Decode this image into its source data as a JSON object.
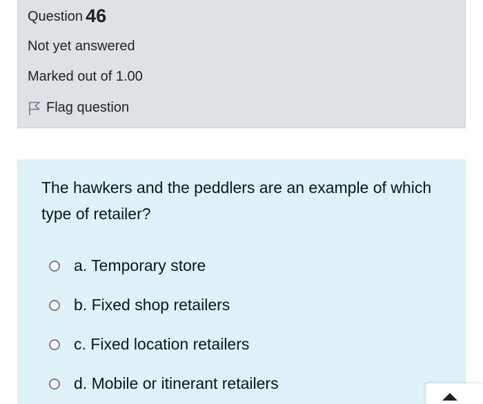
{
  "question_info": {
    "question_prefix": "Question",
    "question_number": "46",
    "status": "Not yet answered",
    "marks": "Marked out of 1.00",
    "flag_label": "Flag question",
    "flag_icon": "flag-outline-icon"
  },
  "question": {
    "text": "The hawkers and the peddlers are an example of which type of retailer?",
    "answers": [
      "a. Temporary store",
      "b. Fixed shop retailers",
      "c. Fixed location retailers",
      "d. Mobile or itinerant retailers"
    ],
    "selected": null
  },
  "floating_button": {
    "icon": "chevron-up-icon"
  },
  "colors": {
    "info_background": "#dee2e6",
    "content_background": "#def2f8",
    "text": "#001a1e"
  }
}
